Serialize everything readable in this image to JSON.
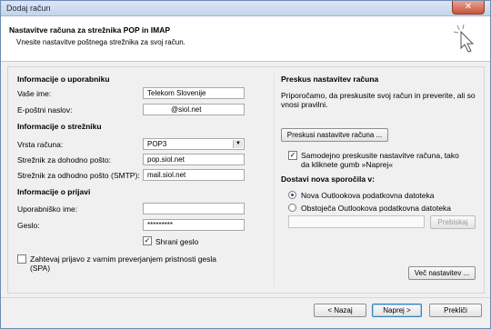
{
  "window": {
    "title": "Dodaj račun",
    "close_glyph": "✕"
  },
  "header": {
    "title": "Nastavitve računa za strežnika POP in IMAP",
    "subtitle": "Vnesite nastavitve poštnega strežnika za svoj račun."
  },
  "left": {
    "user_section": "Informacije o uporabniku",
    "name_label": "Vaše ime:",
    "name_value": "Telekom Slovenije",
    "email_label": "E-poštni naslov:",
    "email_value": "@siol.net",
    "server_section": "Informacije o strežniku",
    "acct_type_label": "Vrsta računa:",
    "acct_type_value": "POP3",
    "incoming_label": "Strežnik za dohodno pošto:",
    "incoming_value": "pop.siol.net",
    "outgoing_label": "Strežnik za odhodno pošto (SMTP):",
    "outgoing_value": "mail.siol.net",
    "login_section": "Informacije o prijavi",
    "username_label": "Uporabniško ime:",
    "username_value": "",
    "password_label": "Geslo:",
    "password_value": "*********",
    "remember_label": "Shrani geslo",
    "remember_checked": true,
    "spa_label_line1": "Zahtevaj prijavo z varnim preverjanjem pristnosti gesla",
    "spa_label_line2": "(SPA)",
    "spa_checked": false
  },
  "right": {
    "test_section": "Preskus nastavitev računa",
    "test_desc_line1": "Priporočamo, da preskusite svoj račun in preverite, ali so",
    "test_desc_line2": "vnosi pravilni.",
    "test_button": "Preskusi nastavitve računa ...",
    "auto_test_line1": "Samodejno preskusite nastavitve računa, tako",
    "auto_test_line2": "da kliknete gumb »Naprej«",
    "auto_test_checked": true,
    "deliver_section": "Dostavi nova sporočila v:",
    "opt_new": "Nova Outlookova podatkovna datoteka",
    "opt_existing": "Obstoječa Outlookova podatkovna datoteka",
    "selected_option": "new",
    "existing_path": "",
    "browse_button": "Prebiskaj",
    "more_settings_button": "Več nastavitev ..."
  },
  "footer": {
    "back": "< Nazaj",
    "next": "Naprej >",
    "cancel": "Prekliči"
  }
}
